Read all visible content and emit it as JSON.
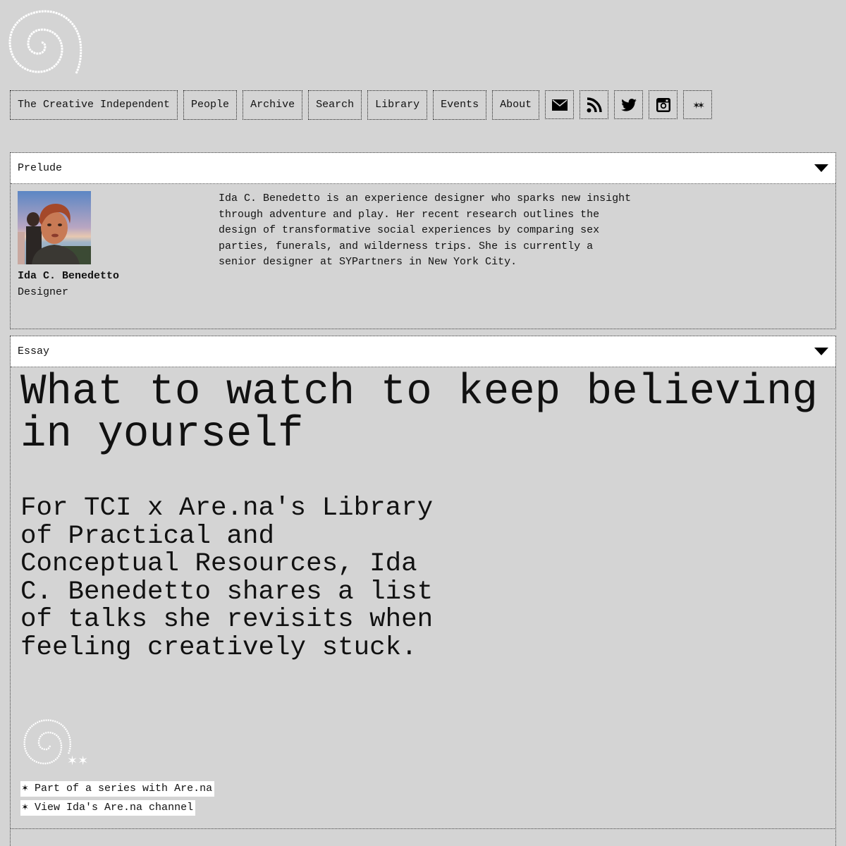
{
  "logo": {
    "icon": "spiral-icon"
  },
  "nav": {
    "items": [
      {
        "label": "The Creative Independent"
      },
      {
        "label": "People"
      },
      {
        "label": "Archive"
      },
      {
        "label": "Search"
      },
      {
        "label": "Library"
      },
      {
        "label": "Events"
      },
      {
        "label": "About"
      }
    ],
    "icons": [
      {
        "name": "email-icon"
      },
      {
        "name": "rss-icon"
      },
      {
        "name": "twitter-icon"
      },
      {
        "name": "instagram-icon"
      },
      {
        "name": "stars-icon",
        "glyph": "✶✶"
      }
    ]
  },
  "prelude": {
    "label": "Prelude",
    "person": {
      "name": "Ida C. Benedetto",
      "role": "Designer"
    },
    "bio": "Ida C. Benedetto is an experience designer who sparks new insight through adventure and play. Her recent research outlines the design of transformative social experiences by comparing sex parties, funerals, and wilderness trips. She is currently a senior designer at SYPartners in New York City."
  },
  "essay": {
    "label": "Essay",
    "headline": "What to watch to keep believing in yourself",
    "dek": "For TCI x Are.na's Library of Practical and Conceptual Resources, Ida C. Benedetto shares a list of talks she revisits when feeling creatively stuck.",
    "links": [
      {
        "label": "✶ Part of a series with Are.na"
      },
      {
        "label": "✶ View Ida's Are.na channel"
      }
    ]
  },
  "colors": {
    "background": "#d4d4d4",
    "panel_header": "#ffffff",
    "text": "#111111"
  }
}
